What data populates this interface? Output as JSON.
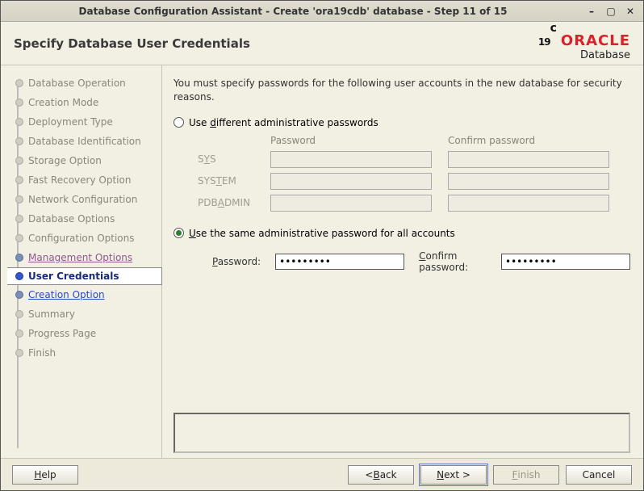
{
  "window": {
    "title": "Database Configuration Assistant - Create 'ora19cdb' database - Step 11 of 15"
  },
  "header": {
    "heading": "Specify Database User Credentials",
    "logo": {
      "version": "19",
      "sup": "c",
      "brand": "ORACLE",
      "product": "Database"
    }
  },
  "steps": [
    {
      "label": "Database Operation",
      "state": "past"
    },
    {
      "label": "Creation Mode",
      "state": "past"
    },
    {
      "label": "Deployment Type",
      "state": "past"
    },
    {
      "label": "Database Identification",
      "state": "past"
    },
    {
      "label": "Storage Option",
      "state": "past"
    },
    {
      "label": "Fast Recovery Option",
      "state": "past"
    },
    {
      "label": "Network Configuration",
      "state": "past"
    },
    {
      "label": "Database Options",
      "state": "past"
    },
    {
      "label": "Configuration Options",
      "state": "past"
    },
    {
      "label": "Management Options",
      "state": "visited"
    },
    {
      "label": "User Credentials",
      "state": "current"
    },
    {
      "label": "Creation Option",
      "state": "adjacent"
    },
    {
      "label": "Summary",
      "state": "future"
    },
    {
      "label": "Progress Page",
      "state": "future"
    },
    {
      "label": "Finish",
      "state": "future"
    }
  ],
  "main": {
    "instruction": "You must specify passwords for the following user accounts in the new database for security reasons.",
    "radio_diff": "Use different administrative passwords",
    "grid_headers": {
      "password": "Password",
      "confirm": "Confirm password"
    },
    "rows": [
      {
        "label": "SYS"
      },
      {
        "label": "SYSTEM"
      },
      {
        "label": "PDBADMIN"
      }
    ],
    "radio_same": "Use the same administrative password for all accounts",
    "same": {
      "password_label": "Password:",
      "confirm_label": "Confirm password:",
      "password_value": "•••••••••",
      "confirm_value": "•••••••••"
    }
  },
  "footer": {
    "help": "Help",
    "back": "< Back",
    "next": "Next >",
    "finish": "Finish",
    "cancel": "Cancel"
  }
}
